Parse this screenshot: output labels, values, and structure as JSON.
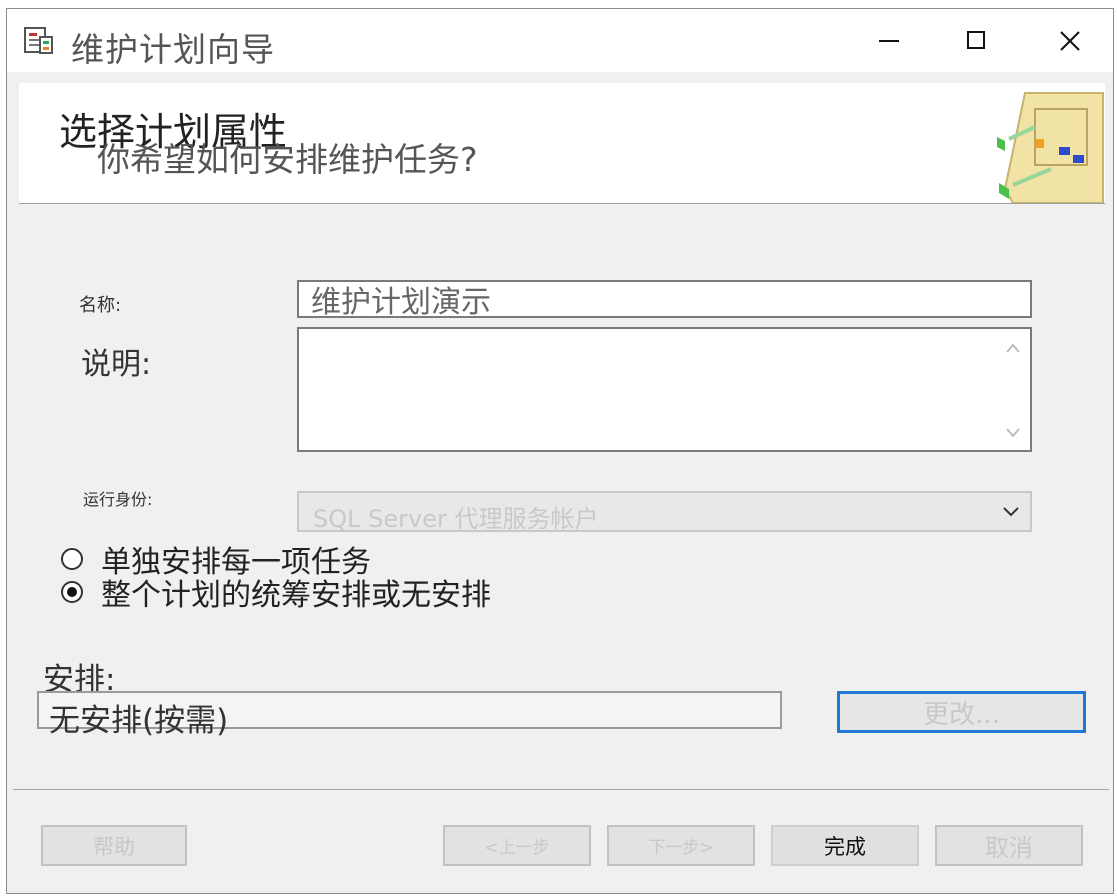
{
  "window": {
    "title": "维护计划向导",
    "app_icon": "wizard-app-icon",
    "controls": {
      "minimize": "minimize-icon",
      "maximize": "maximize-icon",
      "close": "close-icon"
    }
  },
  "header": {
    "title": "选择计划属性",
    "subtitle": "你希望如何安排维护任务?",
    "art_icon": "wizard-banner-icon"
  },
  "form": {
    "name_label": "名称:",
    "name_value": "维护计划演示",
    "description_label": "说明:",
    "description_value": "",
    "run_as_label": "运行身份:",
    "run_as_value": "SQL Server 代理服务帐户"
  },
  "schedule_options": {
    "separate": "单独安排每一项任务",
    "single": "整个计划的统筹安排或无安排",
    "selected": "single"
  },
  "schedule": {
    "label": "安排:",
    "value": "无安排(按需)",
    "change_button": "更改..."
  },
  "footer": {
    "help": "帮助",
    "back": "<上一步",
    "next": "下一步>",
    "finish": "完成",
    "cancel": "取消"
  },
  "colors": {
    "focus_border": "#1e78d4"
  }
}
